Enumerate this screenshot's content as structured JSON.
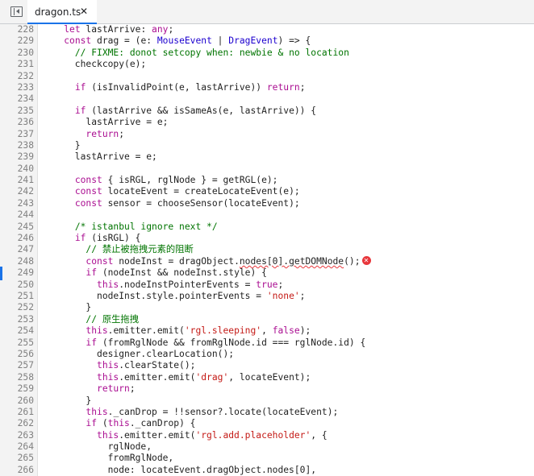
{
  "tab": {
    "title": "dragon.ts",
    "close_glyph": "✕"
  },
  "icons": {
    "sidebar_toggle": "sidebar-toggle-icon",
    "error": "error-icon"
  },
  "colors": {
    "accent": "#1a73e8",
    "keyword": "#aa0d91",
    "string": "#c41a16",
    "comment": "#007400",
    "error": "#e8373c"
  },
  "lines": [
    {
      "n": "228",
      "segs": [
        {
          "t": "    "
        },
        {
          "t": "let",
          "c": "k"
        },
        {
          "t": " lastArrive: "
        },
        {
          "t": "any",
          "c": "k"
        },
        {
          "t": ";"
        }
      ]
    },
    {
      "n": "229",
      "segs": [
        {
          "t": "    "
        },
        {
          "t": "const",
          "c": "k"
        },
        {
          "t": " drag = (e: "
        },
        {
          "t": "MouseEvent",
          "c": "ty"
        },
        {
          "t": " | "
        },
        {
          "t": "DragEvent",
          "c": "ty"
        },
        {
          "t": ") => {"
        }
      ]
    },
    {
      "n": "230",
      "segs": [
        {
          "t": "      "
        },
        {
          "t": "// FIXME: donot setcopy when: newbie & no location",
          "c": "c"
        }
      ]
    },
    {
      "n": "231",
      "segs": [
        {
          "t": "      checkcopy(e);"
        }
      ]
    },
    {
      "n": "232",
      "segs": []
    },
    {
      "n": "233",
      "segs": [
        {
          "t": "      "
        },
        {
          "t": "if",
          "c": "k"
        },
        {
          "t": " (isInvalidPoint(e, lastArrive)) "
        },
        {
          "t": "return",
          "c": "k"
        },
        {
          "t": ";"
        }
      ]
    },
    {
      "n": "234",
      "segs": []
    },
    {
      "n": "235",
      "segs": [
        {
          "t": "      "
        },
        {
          "t": "if",
          "c": "k"
        },
        {
          "t": " (lastArrive && isSameAs(e, lastArrive)) {"
        }
      ]
    },
    {
      "n": "236",
      "segs": [
        {
          "t": "        lastArrive = e;"
        }
      ]
    },
    {
      "n": "237",
      "segs": [
        {
          "t": "        "
        },
        {
          "t": "return",
          "c": "k"
        },
        {
          "t": ";"
        }
      ]
    },
    {
      "n": "238",
      "segs": [
        {
          "t": "      }"
        }
      ]
    },
    {
      "n": "239",
      "segs": [
        {
          "t": "      lastArrive = e;"
        }
      ]
    },
    {
      "n": "240",
      "segs": []
    },
    {
      "n": "241",
      "segs": [
        {
          "t": "      "
        },
        {
          "t": "const",
          "c": "k"
        },
        {
          "t": " { isRGL, rglNode } = getRGL(e);"
        }
      ]
    },
    {
      "n": "242",
      "segs": [
        {
          "t": "      "
        },
        {
          "t": "const",
          "c": "k"
        },
        {
          "t": " locateEvent = createLocateEvent(e);"
        }
      ]
    },
    {
      "n": "243",
      "segs": [
        {
          "t": "      "
        },
        {
          "t": "const",
          "c": "k"
        },
        {
          "t": " sensor = chooseSensor(locateEvent);"
        }
      ]
    },
    {
      "n": "244",
      "segs": []
    },
    {
      "n": "245",
      "segs": [
        {
          "t": "      "
        },
        {
          "t": "/* istanbul ignore next */",
          "c": "c"
        }
      ]
    },
    {
      "n": "246",
      "segs": [
        {
          "t": "      "
        },
        {
          "t": "if",
          "c": "k"
        },
        {
          "t": " (isRGL) {"
        }
      ]
    },
    {
      "n": "247",
      "segs": [
        {
          "t": "        "
        },
        {
          "t": "// 禁止被拖拽元素的阻断",
          "c": "c"
        }
      ]
    },
    {
      "n": "248",
      "segs": [
        {
          "t": "        "
        },
        {
          "t": "const",
          "c": "k"
        },
        {
          "t": " nodeInst = dragObject."
        },
        {
          "t": "nodes[0].getDOMNode",
          "c": "sq"
        },
        {
          "t": "();"
        }
      ],
      "error": true
    },
    {
      "n": "249",
      "segs": [
        {
          "t": "        "
        },
        {
          "t": "if",
          "c": "k"
        },
        {
          "t": " (nodeInst && nodeInst.style) {"
        }
      ]
    },
    {
      "n": "250",
      "segs": [
        {
          "t": "          "
        },
        {
          "t": "this",
          "c": "k"
        },
        {
          "t": ".nodeInstPointerEvents = "
        },
        {
          "t": "true",
          "c": "k"
        },
        {
          "t": ";"
        }
      ]
    },
    {
      "n": "251",
      "segs": [
        {
          "t": "          nodeInst.style.pointerEvents = "
        },
        {
          "t": "'none'",
          "c": "s"
        },
        {
          "t": ";"
        }
      ]
    },
    {
      "n": "252",
      "segs": [
        {
          "t": "        }"
        }
      ]
    },
    {
      "n": "253",
      "segs": [
        {
          "t": "        "
        },
        {
          "t": "// 原生拖拽",
          "c": "c"
        }
      ]
    },
    {
      "n": "254",
      "segs": [
        {
          "t": "        "
        },
        {
          "t": "this",
          "c": "k"
        },
        {
          "t": ".emitter.emit("
        },
        {
          "t": "'rgl.sleeping'",
          "c": "s"
        },
        {
          "t": ", "
        },
        {
          "t": "false",
          "c": "k"
        },
        {
          "t": ");"
        }
      ]
    },
    {
      "n": "255",
      "segs": [
        {
          "t": "        "
        },
        {
          "t": "if",
          "c": "k"
        },
        {
          "t": " (fromRglNode && fromRglNode.id === rglNode.id) {"
        }
      ]
    },
    {
      "n": "256",
      "segs": [
        {
          "t": "          designer.clearLocation();"
        }
      ]
    },
    {
      "n": "257",
      "segs": [
        {
          "t": "          "
        },
        {
          "t": "this",
          "c": "k"
        },
        {
          "t": ".clearState();"
        }
      ]
    },
    {
      "n": "258",
      "segs": [
        {
          "t": "          "
        },
        {
          "t": "this",
          "c": "k"
        },
        {
          "t": ".emitter.emit("
        },
        {
          "t": "'drag'",
          "c": "s"
        },
        {
          "t": ", locateEvent);"
        }
      ]
    },
    {
      "n": "259",
      "segs": [
        {
          "t": "          "
        },
        {
          "t": "return",
          "c": "k"
        },
        {
          "t": ";"
        }
      ]
    },
    {
      "n": "260",
      "segs": [
        {
          "t": "        }"
        }
      ]
    },
    {
      "n": "261",
      "segs": [
        {
          "t": "        "
        },
        {
          "t": "this",
          "c": "k"
        },
        {
          "t": "._canDrop = !!sensor?.locate(locateEvent);"
        }
      ]
    },
    {
      "n": "262",
      "segs": [
        {
          "t": "        "
        },
        {
          "t": "if",
          "c": "k"
        },
        {
          "t": " ("
        },
        {
          "t": "this",
          "c": "k"
        },
        {
          "t": "._canDrop) {"
        }
      ]
    },
    {
      "n": "263",
      "segs": [
        {
          "t": "          "
        },
        {
          "t": "this",
          "c": "k"
        },
        {
          "t": ".emitter.emit("
        },
        {
          "t": "'rgl.add.placeholder'",
          "c": "s"
        },
        {
          "t": ", {"
        }
      ]
    },
    {
      "n": "264",
      "segs": [
        {
          "t": "            rglNode,"
        }
      ]
    },
    {
      "n": "265",
      "segs": [
        {
          "t": "            fromRglNode,"
        }
      ]
    },
    {
      "n": "266",
      "segs": [
        {
          "t": "            node: locateEvent.dragObject.nodes[0],"
        }
      ]
    }
  ]
}
